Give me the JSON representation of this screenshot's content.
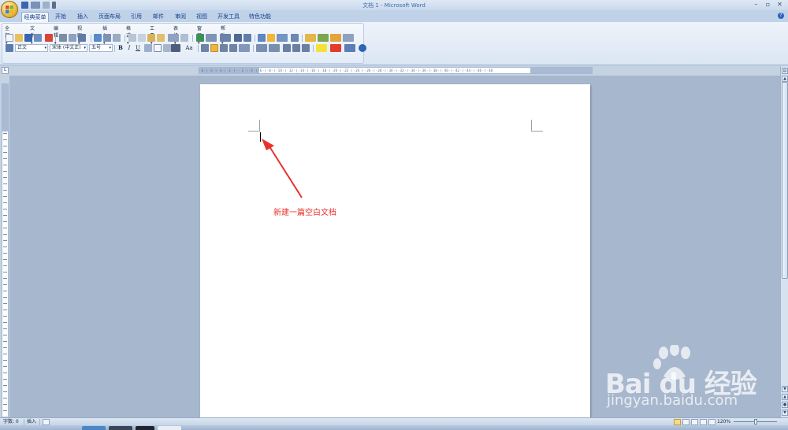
{
  "window": {
    "title": "文档 1 - Microsoft Word"
  },
  "quick_access": {
    "icons": [
      "save-icon",
      "undo-icon",
      "redo-icon",
      "customize-icon"
    ]
  },
  "tabs": [
    {
      "label": "经典菜单",
      "active": true
    },
    {
      "label": "开始"
    },
    {
      "label": "插入"
    },
    {
      "label": "页面布局"
    },
    {
      "label": "引用"
    },
    {
      "label": "邮件"
    },
    {
      "label": "审阅"
    },
    {
      "label": "视图"
    },
    {
      "label": "开发工具"
    },
    {
      "label": "特色功能"
    }
  ],
  "menus": [
    "全部",
    "文件",
    "编辑",
    "视图",
    "插入",
    "格式",
    "工具",
    "表格",
    "窗口",
    "帮助"
  ],
  "formatting": {
    "style": "正文",
    "font": "宋体 (中文正)",
    "size": "五号",
    "bold": "B",
    "italic": "I",
    "underline": "U",
    "font_scale": "Aa"
  },
  "document": {
    "annotation": "新建一篇空白文档"
  },
  "statusbar": {
    "word_count": "字数: 0",
    "mode": "插入",
    "zoom": "120%"
  },
  "watermark": {
    "logo": "Bai du 经验",
    "url": "jingyan.baidu.com"
  },
  "colors": {
    "accent": "#2d64b7",
    "annotation": "#e8322e",
    "title_text": "#3e6aaa"
  }
}
